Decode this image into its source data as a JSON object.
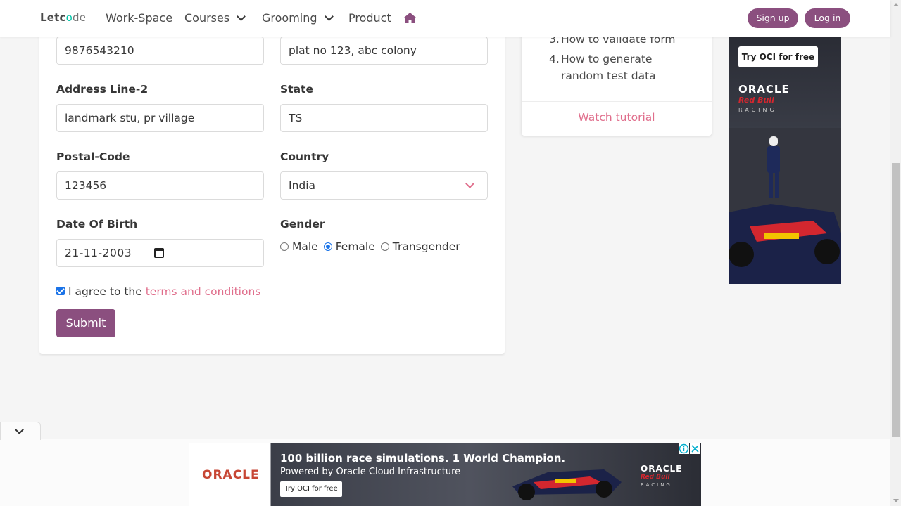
{
  "navbar": {
    "logo_prefix": "Letc",
    "logo_o": "o",
    "logo_suffix": "de",
    "items": [
      {
        "label": "Work-Space"
      },
      {
        "label": "Courses"
      },
      {
        "label": "Grooming"
      },
      {
        "label": "Product"
      }
    ],
    "home_icon": "home-icon",
    "signup_label": "Sign up",
    "login_label": "Log in"
  },
  "form": {
    "phone_value": "9876543210",
    "address1_value": "plat no 123, abc colony",
    "address2_label": "Address Line-2",
    "address2_value": "landmark stu, pr village",
    "state_label": "State",
    "state_value": "TS",
    "postal_label": "Postal-Code",
    "postal_value": "123456",
    "country_label": "Country",
    "country_value": "India",
    "dob_label": "Date Of Birth",
    "dob_value": "21-11-2003",
    "gender_label": "Gender",
    "gender_options": [
      {
        "label": "Male",
        "checked": false
      },
      {
        "label": "Female",
        "checked": true
      },
      {
        "label": "Transgender",
        "checked": false
      }
    ],
    "agree_checked": true,
    "agree_text": "I agree to the ",
    "agree_link": "terms and conditions",
    "submit_label": "Submit"
  },
  "sidebar": {
    "items": [
      {
        "num": "3.",
        "text": "How to validate form"
      },
      {
        "num": "4.",
        "text": "How to generate random test data"
      }
    ],
    "watch_label": "Watch tutorial"
  },
  "ads": {
    "side": {
      "cta": "Try OCI for free",
      "brand": "ORACLE",
      "team": "Red Bull",
      "racing": "RACING"
    },
    "banner": {
      "brand": "ORACLE",
      "headline": "100 billion race simulations. 1 World Champion.",
      "sub": "Powered by Oracle Cloud Infrastructure",
      "cta": "Try OCI for free",
      "brand2": "ORACLE",
      "team": "Red Bull",
      "racing": "RACING"
    }
  },
  "colors": {
    "primary": "#8b4f7f",
    "accent_link": "#e06e8c",
    "radio_check": "#1a73e8"
  }
}
